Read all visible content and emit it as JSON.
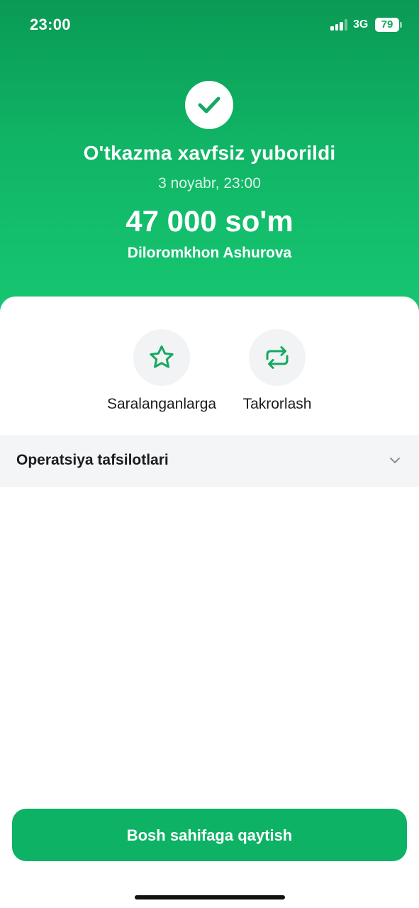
{
  "status_bar": {
    "time": "23:00",
    "network": "3G",
    "battery": "79"
  },
  "receipt": {
    "title": "O'tkazma xavfsiz yuborildi",
    "date": "3 noyabr, 23:00",
    "amount": "47 000 so'm",
    "recipient": "Diloromkhon Ashurova"
  },
  "actions": {
    "favorite_label": "Saralanganlarga",
    "repeat_label": "Takrorlash"
  },
  "details": {
    "title": "Operatsiya tafsilotlari"
  },
  "footer": {
    "home_button_label": "Bosh sahifaga qaytish"
  },
  "colors": {
    "brand_green": "#0db265",
    "icon_green": "#16a862",
    "hero_top": "#0a9a55",
    "hero_bottom": "#17c873"
  },
  "icons": {
    "check": "check-icon",
    "favorite": "star-icon",
    "repeat": "repeat-icon",
    "expand": "chevron-down-icon"
  }
}
